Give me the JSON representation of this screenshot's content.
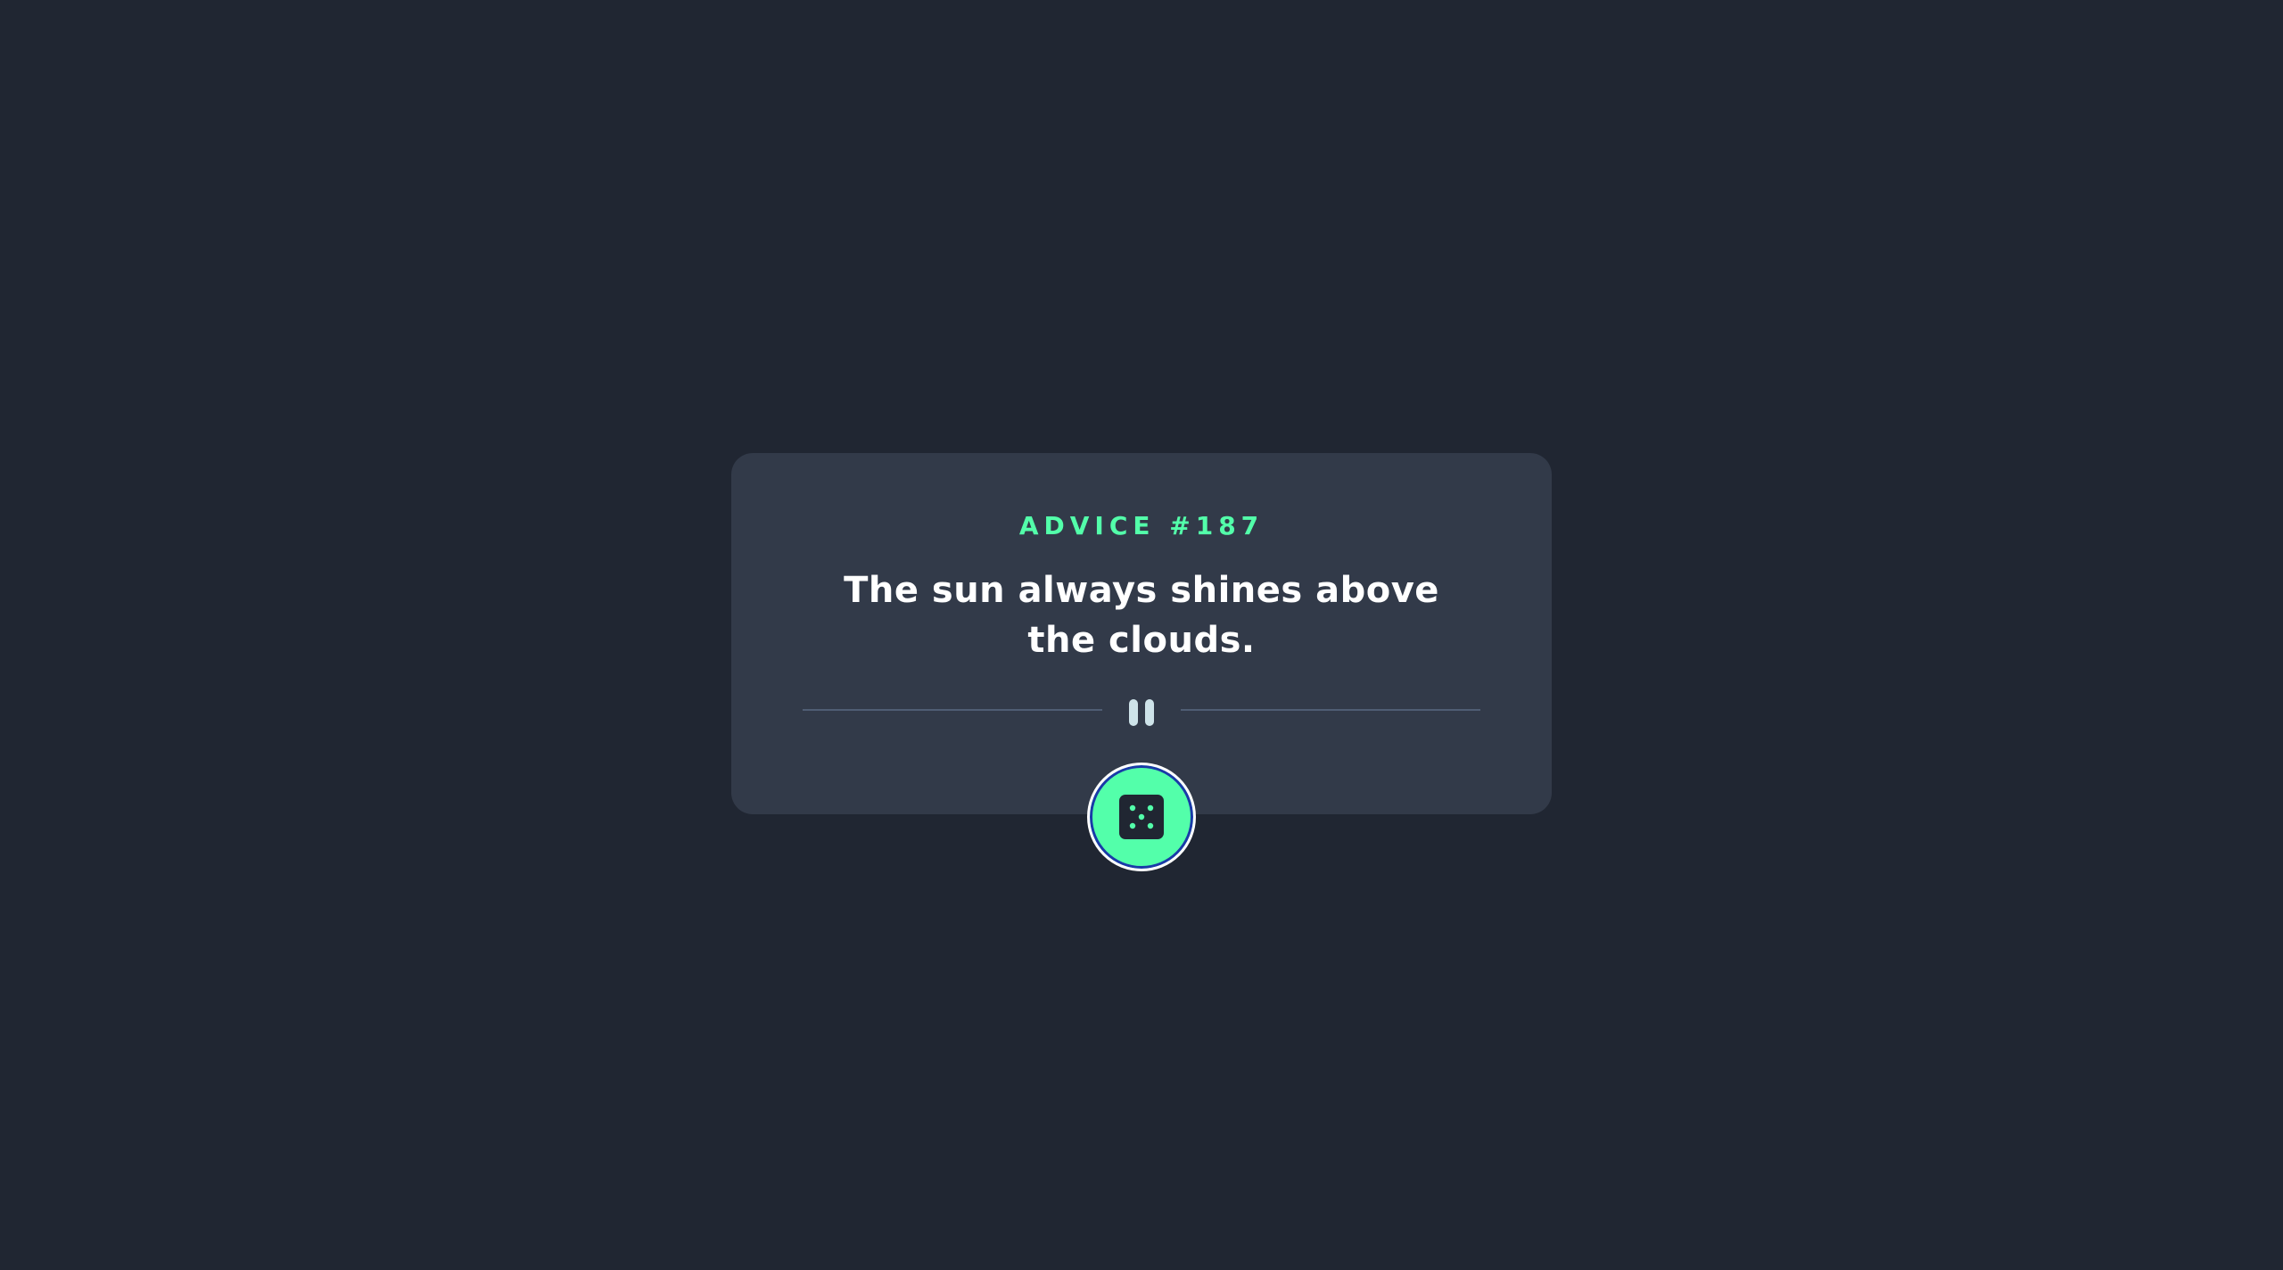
{
  "advice": {
    "id_label": "ADVICE #187",
    "text": "The sun always shines above the clouds."
  },
  "icons": {
    "divider": "pause-quote-icon",
    "button": "dice-icon"
  },
  "colors": {
    "background": "#202632",
    "card": "#323a49",
    "accent": "#53ffaa",
    "text": "#ffffff",
    "divider": "#4f5d74",
    "pause": "#cee3e9"
  }
}
